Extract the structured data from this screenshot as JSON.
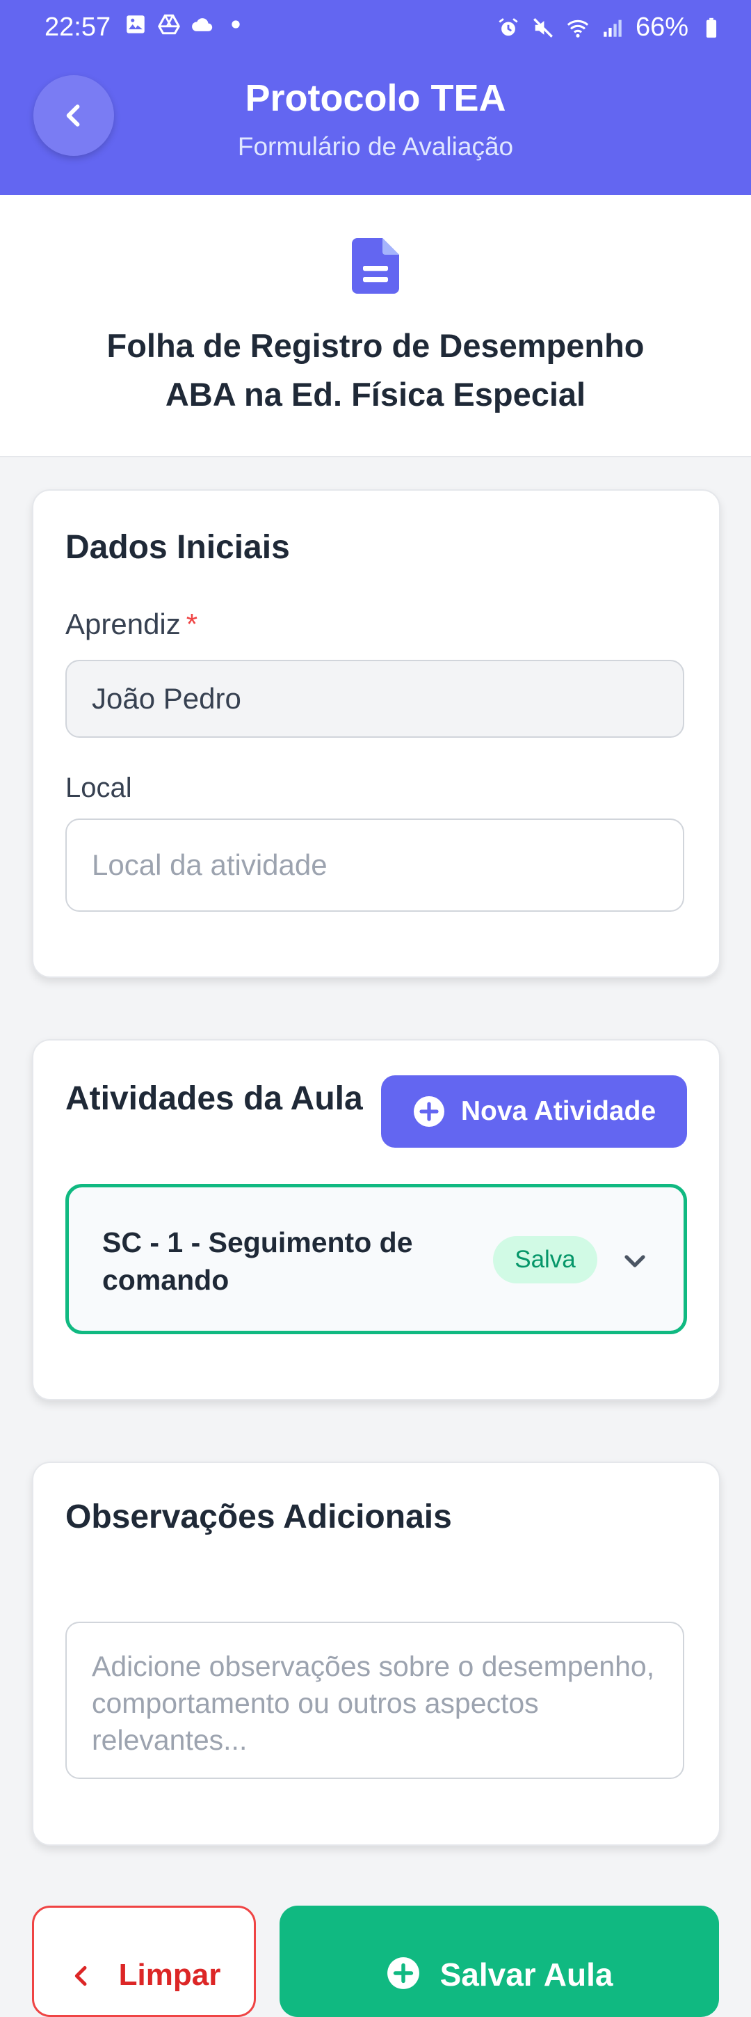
{
  "status_bar": {
    "time": "22:57",
    "battery": "66%",
    "left_icons": [
      "image-icon",
      "drive-icon",
      "cloud-icon",
      "dot-icon"
    ],
    "right_icons": [
      "alarm-icon",
      "mute-icon",
      "wifi-icon",
      "signal-icon",
      "battery-icon"
    ]
  },
  "header": {
    "title": "Protocolo TEA",
    "subtitle": "Formulário de Avaliação",
    "back_icon": "chevron-left-icon"
  },
  "document": {
    "icon": "document-icon",
    "title_line1": "Folha de Registro de Desempenho",
    "title_line2": "ABA na Ed. Física Especial"
  },
  "initial_data": {
    "title": "Dados Iniciais",
    "learner_label": "Aprendiz",
    "required_mark": "*",
    "learner_value": "João Pedro",
    "location_label": "Local",
    "location_placeholder": "Local da atividade"
  },
  "activities": {
    "title": "Atividades da Aula",
    "new_button_label": "Nova Atividade",
    "items": [
      {
        "name": "SC - 1 - Seguimento de comando",
        "status": "Salva"
      }
    ]
  },
  "observations": {
    "title": "Observações Adicionais",
    "placeholder": "Adicione observações sobre o desempenho, comportamento ou outros aspectos relevantes..."
  },
  "footer": {
    "clear_label": "Limpar",
    "save_label": "Salvar Aula"
  },
  "colors": {
    "primary": "#6366f1",
    "success": "#10b981",
    "danger": "#ef4444"
  }
}
